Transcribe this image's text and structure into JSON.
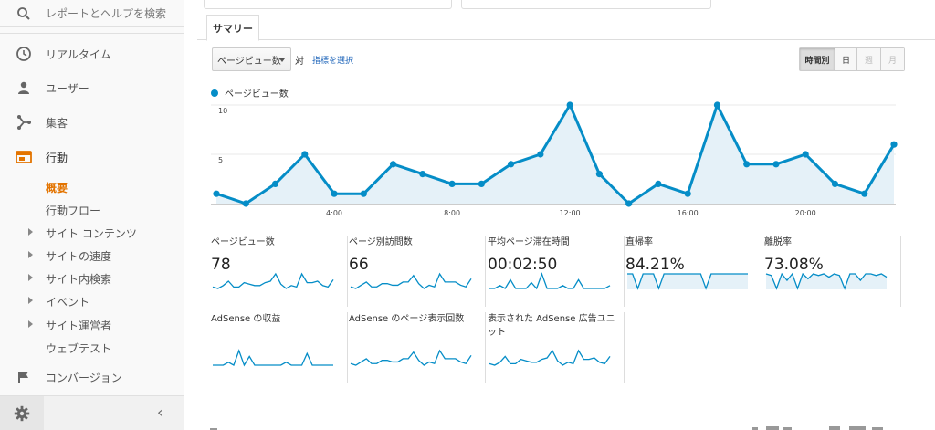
{
  "sidebar": {
    "search_label": "レポートとヘルプを検索",
    "items": [
      {
        "label": "リアルタイム",
        "icon": "clock-icon"
      },
      {
        "label": "ユーザー",
        "icon": "person-icon"
      },
      {
        "label": "集客",
        "icon": "acquisition-icon"
      },
      {
        "label": "行動",
        "icon": "behavior-icon"
      }
    ],
    "behavior_sub": [
      {
        "label": "概要",
        "arrow": false,
        "active": true
      },
      {
        "label": "行動フロー",
        "arrow": false,
        "active": false
      },
      {
        "label": "サイト コンテンツ",
        "arrow": true,
        "active": false
      },
      {
        "label": "サイトの速度",
        "arrow": true,
        "active": false
      },
      {
        "label": "サイト内検索",
        "arrow": true,
        "active": false
      },
      {
        "label": "イベント",
        "arrow": true,
        "active": false
      },
      {
        "label": "サイト運営者",
        "arrow": true,
        "active": false
      },
      {
        "label": "ウェブテスト",
        "arrow": false,
        "active": false
      }
    ],
    "conversions_label": "コンバージョン",
    "collapse_glyph": "‹"
  },
  "tabs": {
    "summary": "サマリー"
  },
  "controls": {
    "metric_select": "ページビュー数",
    "vs": "対",
    "select_metric": "指標を選択",
    "granularity": [
      "時間別",
      "日",
      "週",
      "月"
    ]
  },
  "colors": {
    "accent": "#058dc7",
    "fill": "#e5f1f8",
    "orange": "#e37400"
  },
  "chart_data": {
    "type": "area",
    "series": [
      {
        "name": "ページビュー数",
        "values": [
          1,
          0,
          2,
          5,
          1,
          1,
          4,
          3,
          2,
          2,
          4,
          5,
          10,
          3,
          0,
          2,
          1,
          10,
          4,
          4,
          5,
          2,
          1,
          6
        ]
      }
    ],
    "x_ticks": [
      {
        "index": 0,
        "label": "..."
      },
      {
        "index": 4,
        "label": "4:00"
      },
      {
        "index": 8,
        "label": "8:00"
      },
      {
        "index": 12,
        "label": "12:00"
      },
      {
        "index": 16,
        "label": "16:00"
      },
      {
        "index": 20,
        "label": "20:00"
      }
    ],
    "y_ticks": [
      5,
      10
    ],
    "ylim": [
      0,
      10
    ],
    "grid": true
  },
  "scorecards": [
    {
      "name": "ページビュー数",
      "value": "78",
      "spark": [
        1,
        0,
        2,
        5,
        1,
        1,
        4,
        3,
        2,
        2,
        4,
        5,
        10,
        3,
        0,
        2,
        1,
        10,
        4,
        4,
        5,
        2,
        1,
        6
      ],
      "fill": false
    },
    {
      "name": "ページ別訪問数",
      "value": "66",
      "spark": [
        1,
        0,
        2,
        4,
        1,
        1,
        3,
        3,
        2,
        2,
        4,
        4,
        8,
        3,
        0,
        2,
        1,
        9,
        4,
        4,
        4,
        2,
        1,
        6
      ],
      "fill": false
    },
    {
      "name": "平均ページ滞在時間",
      "value": "00:02:50",
      "spark": [
        0,
        0,
        1,
        0,
        3,
        0,
        0,
        0,
        2,
        0,
        5,
        0,
        0,
        0,
        1,
        0,
        0,
        3,
        0,
        0,
        0,
        0,
        0,
        1
      ],
      "fill": false
    },
    {
      "name": "直帰率",
      "value": "84.21%",
      "spark": [
        9,
        9,
        0,
        9,
        9,
        9,
        0,
        9,
        9,
        9,
        9,
        9,
        9,
        9,
        9,
        0,
        9,
        9,
        9,
        9,
        9,
        9,
        9,
        9
      ],
      "fill": true
    },
    {
      "name": "離脱率",
      "value": "73.08%",
      "spark": [
        9,
        8,
        0,
        9,
        5,
        9,
        0,
        9,
        6,
        9,
        8,
        9,
        7,
        9,
        8,
        0,
        9,
        9,
        5,
        9,
        9,
        8,
        9,
        7
      ],
      "fill": true
    },
    {
      "name": "AdSense の収益",
      "value": "",
      "spark": [
        0,
        0,
        0,
        1,
        0,
        5,
        0,
        3,
        0,
        0,
        0,
        0,
        0,
        0,
        1,
        0,
        0,
        0,
        4,
        0,
        0,
        0,
        0,
        0
      ],
      "fill": false
    },
    {
      "name": "AdSense のページ表示回数",
      "value": "",
      "spark": [
        1,
        0,
        2,
        4,
        1,
        1,
        3,
        3,
        2,
        2,
        4,
        4,
        8,
        3,
        0,
        2,
        1,
        9,
        4,
        4,
        4,
        2,
        1,
        6
      ],
      "fill": false
    },
    {
      "name": "表示された AdSense 広告ユニット",
      "value": "",
      "spark": [
        1,
        0,
        2,
        6,
        1,
        1,
        4,
        3,
        2,
        2,
        4,
        5,
        10,
        3,
        0,
        2,
        1,
        10,
        4,
        4,
        5,
        2,
        1,
        6
      ],
      "fill": false
    }
  ]
}
